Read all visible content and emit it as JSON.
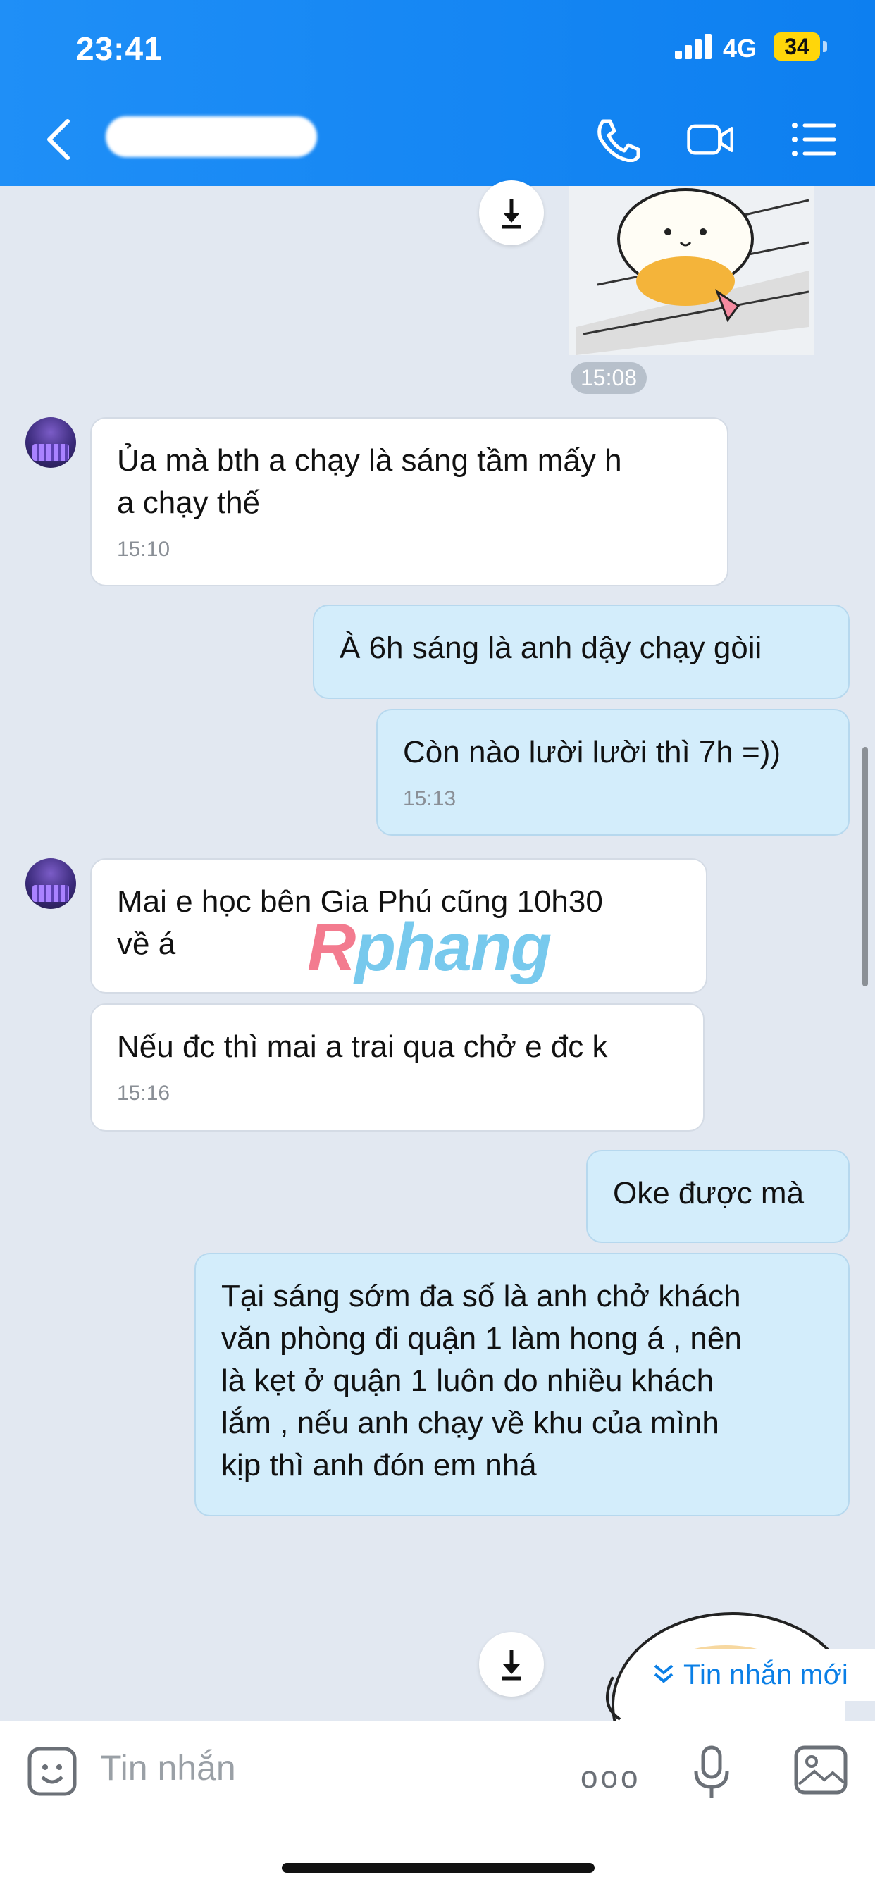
{
  "status_bar": {
    "time": "23:41",
    "network": "4G",
    "battery": "34"
  },
  "header": {
    "back_icon": "chevron-left-icon",
    "call_icon": "phone-icon",
    "video_icon": "video-camera-icon",
    "menu_icon": "list-menu-icon"
  },
  "messages": [
    {
      "sender": "them",
      "text": "Ủa mà bth a chạy là sáng tầm mấy h\na chạy thế",
      "time": "15:10"
    },
    {
      "sender": "me",
      "text": "À 6h sáng là anh dậy chạy gòii",
      "time": ""
    },
    {
      "sender": "me",
      "text": "Còn nào lười lười thì 7h =))",
      "time": "15:13"
    },
    {
      "sender": "them",
      "text": "Mai e học bên Gia Phú cũng 10h30\nvề á",
      "time": ""
    },
    {
      "sender": "them",
      "text": "Nếu đc thì mai a trai qua chở e đc k",
      "time": "15:16"
    },
    {
      "sender": "me",
      "text": "Oke được mà",
      "time": ""
    },
    {
      "sender": "me",
      "text": "Tại sáng sớm đa số là anh chở khách\nvăn phòng đi quận 1 làm hong á , nên\nlà kẹt ở quận 1 luôn do nhiều khách\nlắm , nếu anh chạy về khu của mình\nkịp thì anh đón em nhá",
      "time": ""
    }
  ],
  "sticker_time": "15:08",
  "watermark": {
    "part1": "R",
    "part2": "phang"
  },
  "new_messages_label": "Tin nhắn mới",
  "input": {
    "placeholder": "Tin nhắn",
    "more_label": "ooo"
  },
  "colors": {
    "header": "#1f8ff7",
    "incoming": "#ffffff",
    "outgoing": "#d3edfb",
    "background": "#e2e8f1",
    "accent": "#0a7fe6"
  }
}
